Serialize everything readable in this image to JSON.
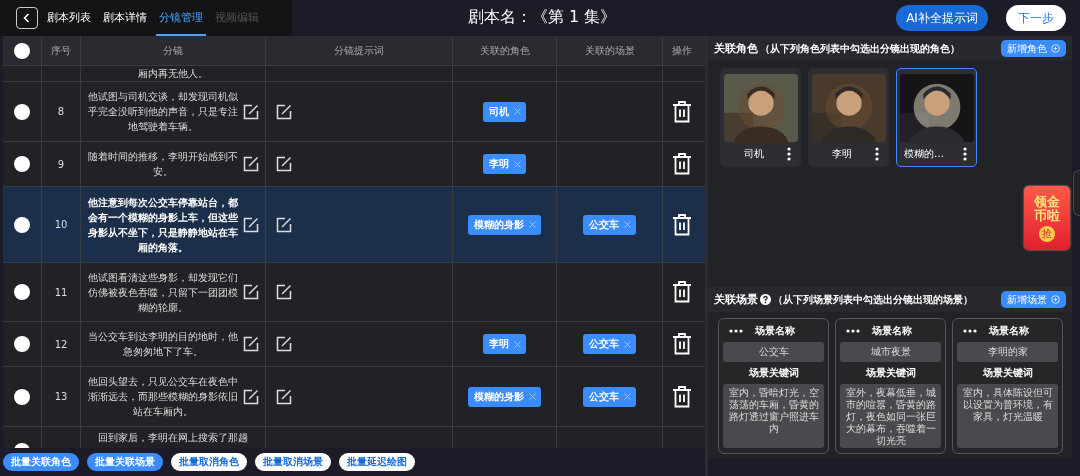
{
  "header": {
    "tabs": [
      {
        "label": "剧本列表",
        "selected": false,
        "disabled": false
      },
      {
        "label": "剧本详情",
        "selected": false,
        "disabled": false
      },
      {
        "label": "分镜管理",
        "selected": true,
        "disabled": false
      },
      {
        "label": "视频编辑",
        "selected": false,
        "disabled": true
      }
    ],
    "title": "剧本名：《第 1 集》",
    "buttons": [
      {
        "label": "AI补全提示词",
        "kind": "primary"
      },
      {
        "label": "下一步",
        "kind": "secondary"
      }
    ]
  },
  "table": {
    "select_all_checked": false,
    "columns": [
      "序号",
      "分镜",
      "分镜提示词",
      "关联的角色",
      "关联的场景",
      "操作"
    ],
    "rows": [
      {
        "kind": "partial_top",
        "text": "厢内再无他人。",
        "selected": false
      },
      {
        "kind": "full",
        "number": "8",
        "text": "他试图与司机交谈，却发现司机似乎完全没听到他的声音，只是专注地驾驶着车辆。",
        "roles": [
          "司机"
        ],
        "scenes": [],
        "selected": false
      },
      {
        "kind": "full",
        "number": "9",
        "text": "随着时间的推移，李明开始感到不安。",
        "roles": [
          "李明"
        ],
        "scenes": [],
        "selected": false
      },
      {
        "kind": "full",
        "number": "10",
        "text": "他注意到每次公交车停靠站台，都会有一个模糊的身影上车，但这些身影从不坐下，只是静静地站在车厢的角落。",
        "roles": [
          "模糊的身影"
        ],
        "scenes": [
          "公交车"
        ],
        "selected": true
      },
      {
        "kind": "full",
        "number": "11",
        "text": "他试图看清这些身影，却发现它们仿佛被夜色吞噬，只留下一团团模糊的轮廓。",
        "roles": [],
        "scenes": [],
        "selected": false
      },
      {
        "kind": "full",
        "number": "12",
        "text": "当公交车到达李明的目的地时，他急匆匆地下了车。",
        "roles": [
          "李明"
        ],
        "scenes": [
          "公交车"
        ],
        "selected": false
      },
      {
        "kind": "full",
        "number": "13",
        "text": "他回头望去，只见公交车在夜色中渐渐远去，而那些模糊的身影依旧站在车厢内。",
        "roles": [
          "模糊的身影"
        ],
        "scenes": [
          "公交车"
        ],
        "selected": false
      },
      {
        "kind": "partial_bottom",
        "text": "回到家后，李明在网上搜索了那趟",
        "selected": false
      }
    ]
  },
  "batch_buttons": [
    {
      "label": "批量关联角色",
      "kind": "primary"
    },
    {
      "label": "批量关联场景",
      "kind": "primary"
    },
    {
      "label": "批量取消角色",
      "kind": "secondary"
    },
    {
      "label": "批量取消场景",
      "kind": "secondary"
    },
    {
      "label": "批量延迟绘图",
      "kind": "secondary"
    }
  ],
  "characters": {
    "title": "关联角色",
    "hint": "（从下列角色列表中勾选出分镜出现的角色）",
    "add_button": "新增角色",
    "items": [
      {
        "name": "司机",
        "selected": false
      },
      {
        "name": "李明",
        "selected": false
      },
      {
        "name": "模糊的…",
        "selected": true
      }
    ]
  },
  "scenes": {
    "title": "关联场景",
    "hint": "（从下列场景列表中勾选出分镜出现的场景）",
    "add_button": "新增场景",
    "items": [
      {
        "name_label": "场景名称",
        "name": "公交车",
        "keywords_label": "场景关键词",
        "keywords": "室内，昏暗灯光，空荡荡的车厢，昏黄的路灯透过窗户照进车内"
      },
      {
        "name_label": "场景名称",
        "name": "城市夜景",
        "keywords_label": "场景关键词",
        "keywords": "室外，夜幕低垂，城市的喧嚣，昏黄的路灯，夜色如同一张巨大的幕布，吞噬着一切光亮"
      },
      {
        "name_label": "场景名称",
        "name": "李明的家",
        "keywords_label": "场景关键词",
        "keywords": "室内，具体陈设但可以设置为普环境，有家具，灯光温暖"
      }
    ]
  },
  "promo_badge": {
    "text": "领金币啦",
    "button": "抢"
  }
}
